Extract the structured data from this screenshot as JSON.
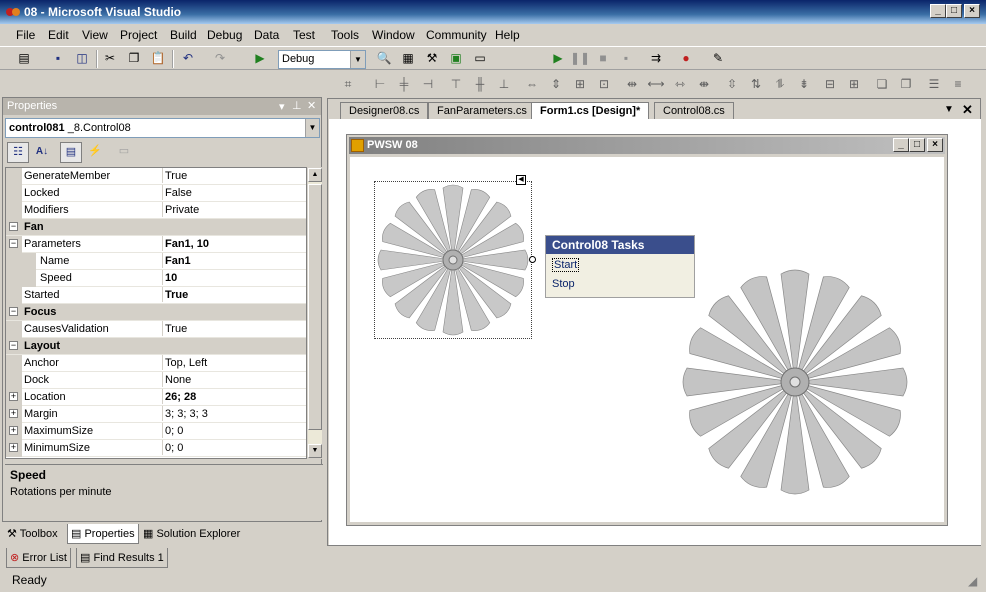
{
  "window": {
    "title": "08 - Microsoft Visual Studio",
    "min": "_",
    "max": "□",
    "close": "×"
  },
  "menu": [
    "File",
    "Edit",
    "View",
    "Project",
    "Build",
    "Debug",
    "Data",
    "Test",
    "Tools",
    "Window",
    "Community",
    "Help"
  ],
  "toolbar": {
    "config": "Debug"
  },
  "properties": {
    "title": "Properties",
    "object": "control081",
    "object_type": "_8.Control08",
    "rows": [
      {
        "name": "GenerateMember",
        "value": "True",
        "type": "prop"
      },
      {
        "name": "Locked",
        "value": "False",
        "type": "prop"
      },
      {
        "name": "Modifiers",
        "value": "Private",
        "type": "prop"
      },
      {
        "name": "Fan",
        "value": "",
        "type": "cat"
      },
      {
        "name": "Parameters",
        "value": "Fan1, 10",
        "type": "expand",
        "bold": true
      },
      {
        "name": "Name",
        "value": "Fan1",
        "type": "sub",
        "bold": true
      },
      {
        "name": "Speed",
        "value": "10",
        "type": "sub",
        "bold": true
      },
      {
        "name": "Started",
        "value": "True",
        "type": "prop",
        "bold": true
      },
      {
        "name": "Focus",
        "value": "",
        "type": "cat"
      },
      {
        "name": "CausesValidation",
        "value": "True",
        "type": "prop"
      },
      {
        "name": "Layout",
        "value": "",
        "type": "cat"
      },
      {
        "name": "Anchor",
        "value": "Top, Left",
        "type": "prop"
      },
      {
        "name": "Dock",
        "value": "None",
        "type": "prop"
      },
      {
        "name": "Location",
        "value": "26; 28",
        "type": "expand",
        "bold": true
      },
      {
        "name": "Margin",
        "value": "3; 3; 3; 3",
        "type": "expand"
      },
      {
        "name": "MaximumSize",
        "value": "0; 0",
        "type": "expand"
      },
      {
        "name": "MinimumSize",
        "value": "0; 0",
        "type": "expand"
      }
    ],
    "desc_title": "Speed",
    "desc_text": "Rotations per minute"
  },
  "dock_tabs": [
    "Toolbox",
    "Properties",
    "Solution Explorer"
  ],
  "bottom_tabs": [
    "Error List",
    "Find Results 1"
  ],
  "doc_tabs": [
    "Designer08.cs",
    "FanParameters.cs",
    "Form1.cs [Design]*",
    "Control08.cs"
  ],
  "form": {
    "title": "PWSW 08"
  },
  "tasks": {
    "title": "Control08 Tasks",
    "start": "Start",
    "stop": "Stop"
  },
  "status": "Ready"
}
